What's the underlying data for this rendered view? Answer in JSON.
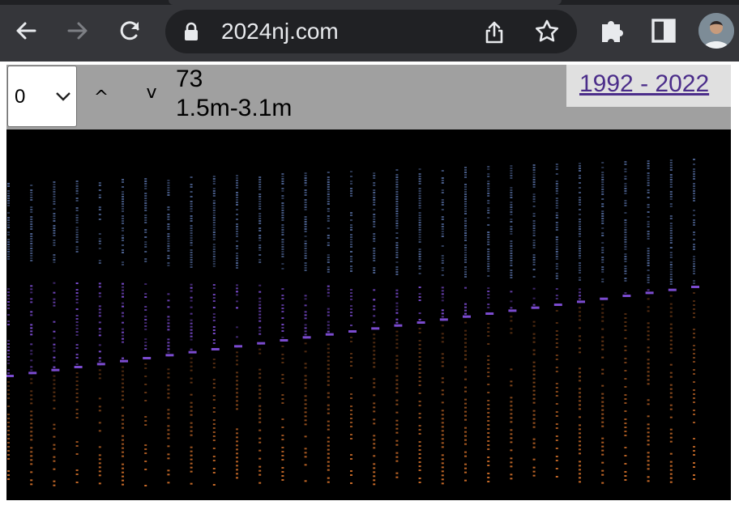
{
  "browser": {
    "url": "2024nj.com",
    "icons": {
      "back": "back-arrow-icon",
      "forward": "forward-arrow-icon",
      "reload": "reload-icon",
      "lock": "lock-icon",
      "share": "share-icon",
      "bookmark": "star-icon",
      "extensions": "puzzle-icon",
      "sidepanel": "side-panel-icon",
      "profile": "avatar"
    }
  },
  "toolbar": {
    "select_value": "0",
    "up_label": "^",
    "down_label": "v",
    "count": "73",
    "range": "1.5m-3.1m",
    "year_link": "1992 - 2022"
  },
  "colors": {
    "background": "#000000",
    "toolbar": "#a0a0a0",
    "blue_band": "#4a5f8c",
    "purple_band": "#7b4bd0",
    "orange_band": "#c86a28",
    "link": "#4b2d8a"
  }
}
